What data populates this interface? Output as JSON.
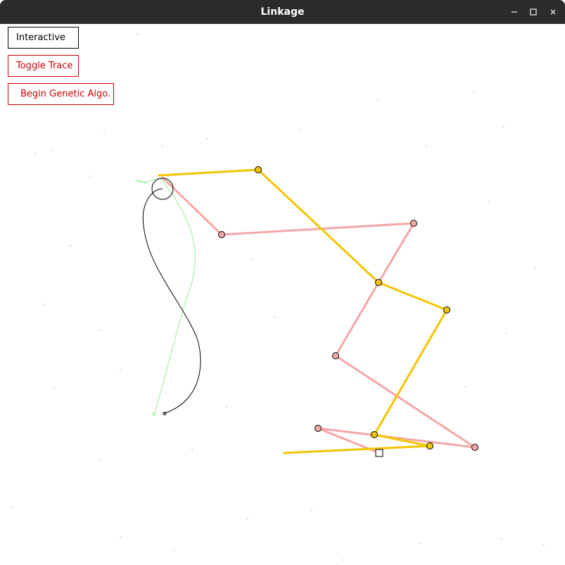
{
  "window": {
    "title": "Linkage"
  },
  "buttons": {
    "interactive": "Interactive",
    "toggle_trace": "Toggle Trace",
    "genetic": "Begin Genetic Algo."
  },
  "colors": {
    "titlebar": "#2b2b2b",
    "link_yellow": "#f5c400",
    "link_pink": "#f4a7a7",
    "trace_black": "#000000",
    "trace_green": "#90ee90",
    "button_red": "#cc0000"
  },
  "icons": {
    "minimize": "minimize-icon",
    "maximize": "maximize-icon",
    "close": "close-icon"
  }
}
